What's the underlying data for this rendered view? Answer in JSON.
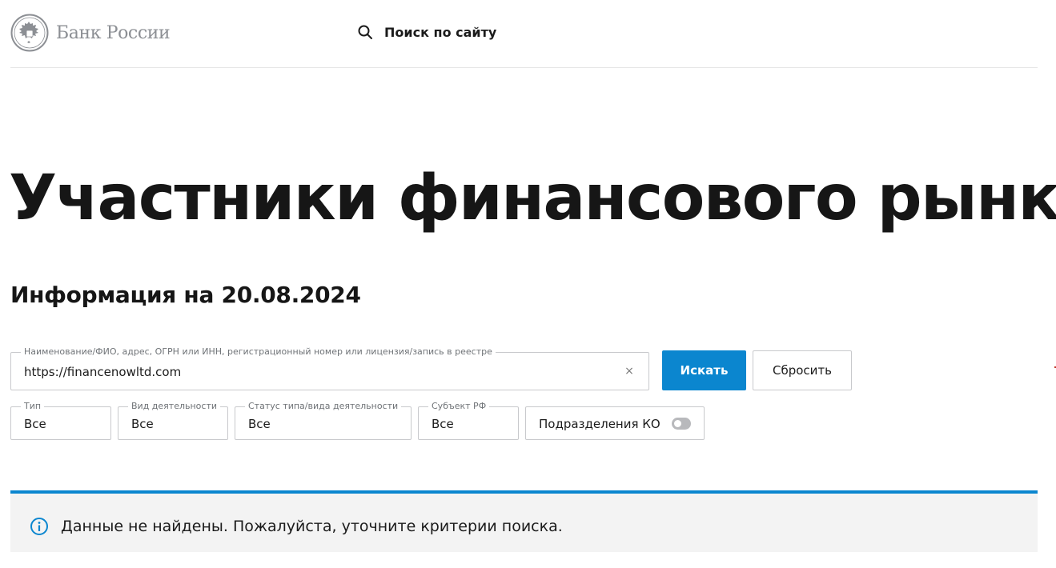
{
  "header": {
    "logo_text": "Банк России",
    "site_search_label": "Поиск по сайту"
  },
  "main": {
    "title": "Участники финансового рынка",
    "info_date": "Информация на 20.08.2024"
  },
  "search": {
    "label": "Наименование/ФИО, адрес, ОГРН или ИНН, регистрационный номер или лицензия/запись в реестре",
    "value": "https://financenowltd.com",
    "clear_symbol": "×",
    "search_button_label": "Искать",
    "reset_button_label": "Сбросить"
  },
  "filters": [
    {
      "label": "Тип",
      "value": "Все"
    },
    {
      "label": "Вид деятельности",
      "value": "Все"
    },
    {
      "label": "Статус типа/вида деятельности",
      "value": "Все"
    },
    {
      "label": "Субъект РФ",
      "value": "Все"
    }
  ],
  "branches_toggle": {
    "label": "Подразделения КО",
    "enabled": false
  },
  "notice": {
    "message": "Данные не найдены. Пожалуйста, уточните критерии поиска.",
    "icon": "info-icon"
  },
  "colors": {
    "accent": "#0b86cf",
    "notice_background": "#f3f3f3",
    "logo_gray": "#8c8f94"
  }
}
